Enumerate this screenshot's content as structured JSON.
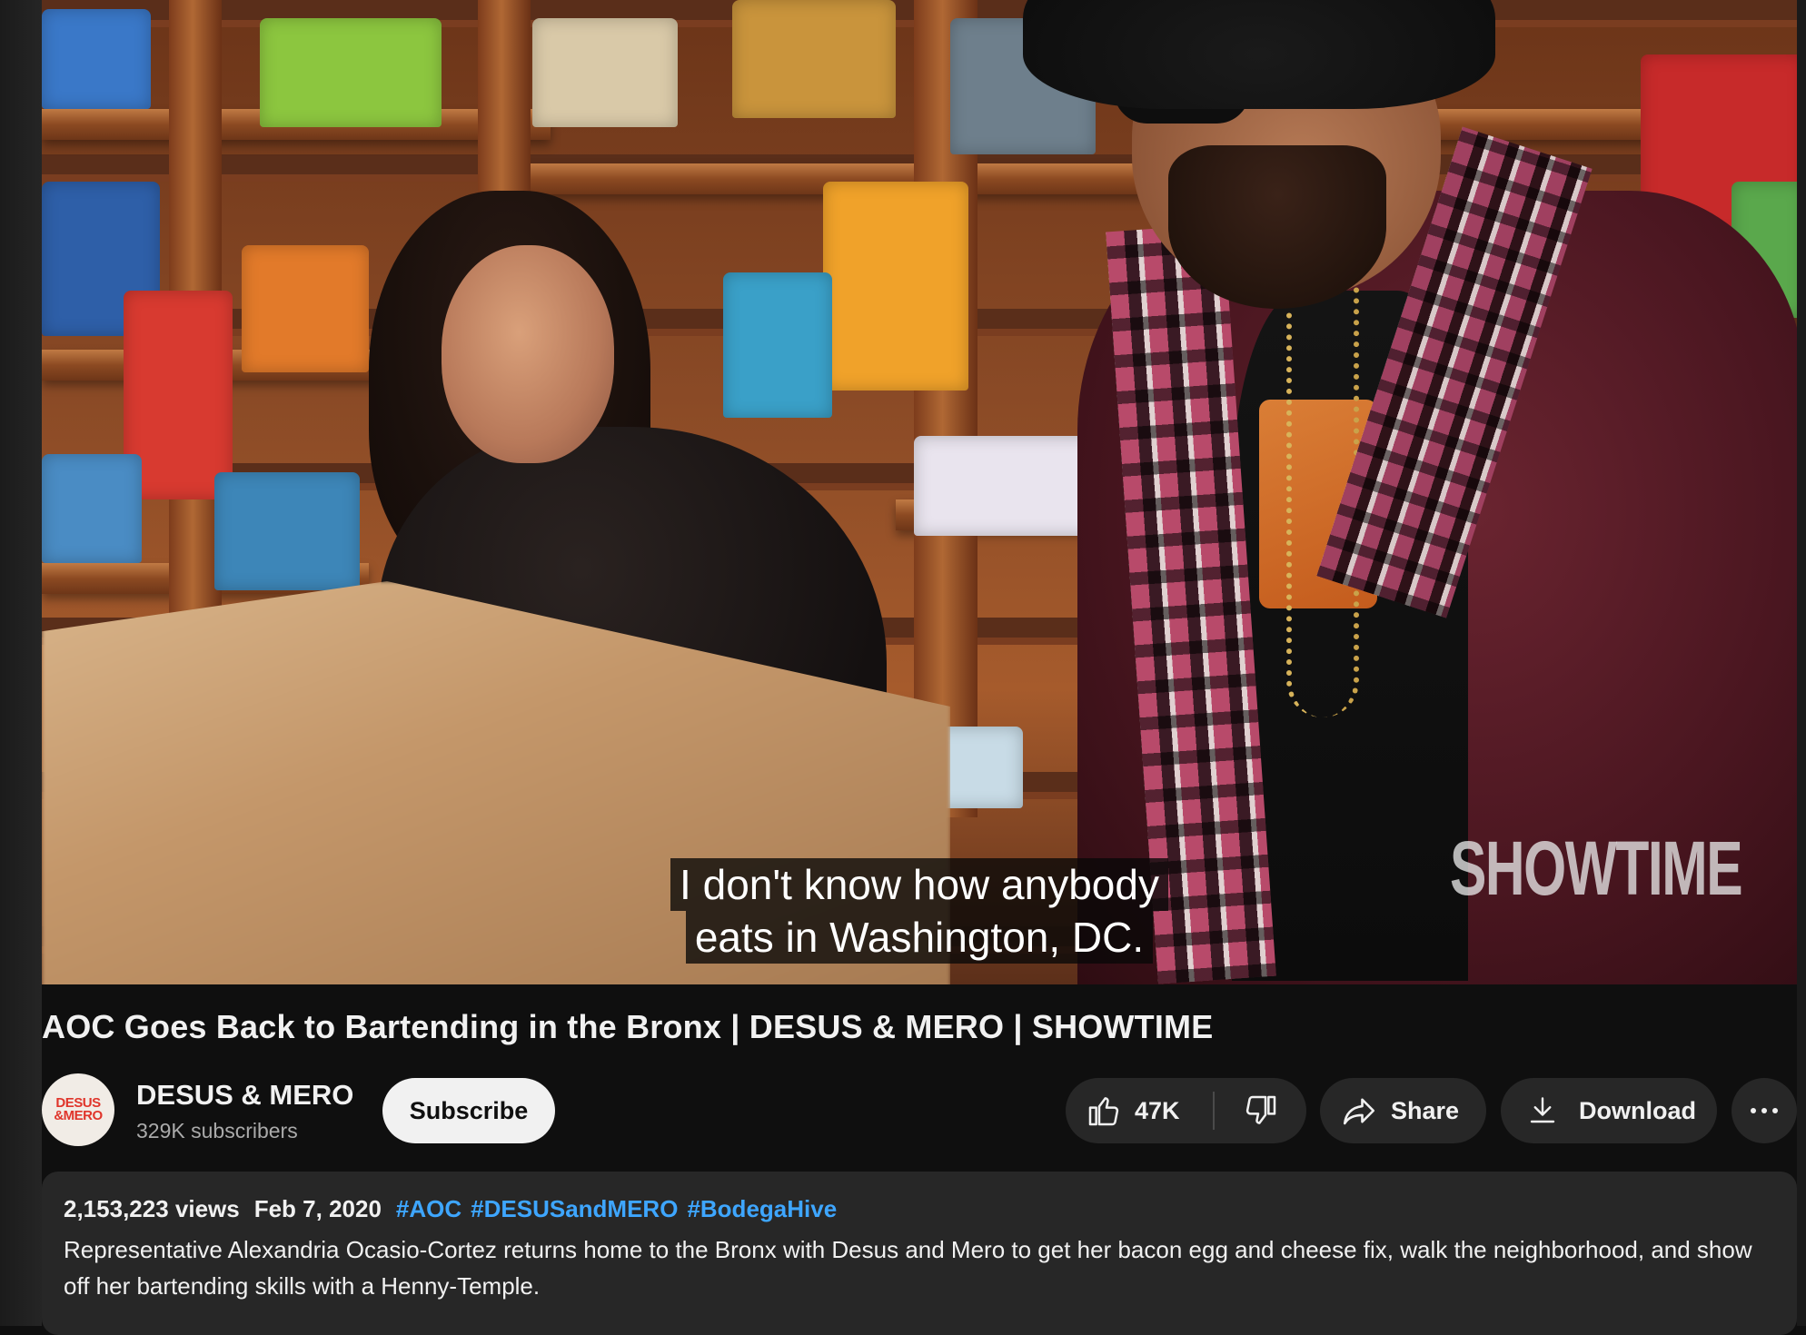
{
  "player": {
    "captions": [
      "I don't know how anybody",
      "eats in Washington, DC."
    ],
    "watermark": "SHOWTIME"
  },
  "video": {
    "title": "AOC Goes Back to Bartending in the Bronx | DESUS & MERO | SHOWTIME"
  },
  "channel": {
    "avatar_text_line1": "DESUS",
    "avatar_text_line2": "&MERO",
    "name": "DESUS & MERO",
    "subscribers": "329K subscribers"
  },
  "actions": {
    "subscribe_label": "Subscribe",
    "like_count": "47K",
    "share_label": "Share",
    "download_label": "Download"
  },
  "icons": {
    "like": "thumbs-up-icon",
    "dislike": "thumbs-down-icon",
    "share": "share-arrow-icon",
    "download": "download-icon",
    "more": "more-horizontal-icon"
  },
  "description": {
    "views": "2,153,223 views",
    "date": "Feb 7, 2020",
    "hashtags": [
      "#AOC",
      "#DESUSandMERO",
      "#BodegaHive"
    ],
    "text": "Representative Alexandria Ocasio-Cortez returns home to the Bronx with Desus and Mero to get her bacon egg and cheese fix, walk the neighborhood, and show off her bartending skills with a Henny-Temple."
  },
  "colors": {
    "background": "#0f0f0f",
    "surface": "#272727",
    "hashtag": "#3ea6ff",
    "subscribe_bg": "#f1f1f1",
    "secondary_text": "#aaaaaa"
  }
}
